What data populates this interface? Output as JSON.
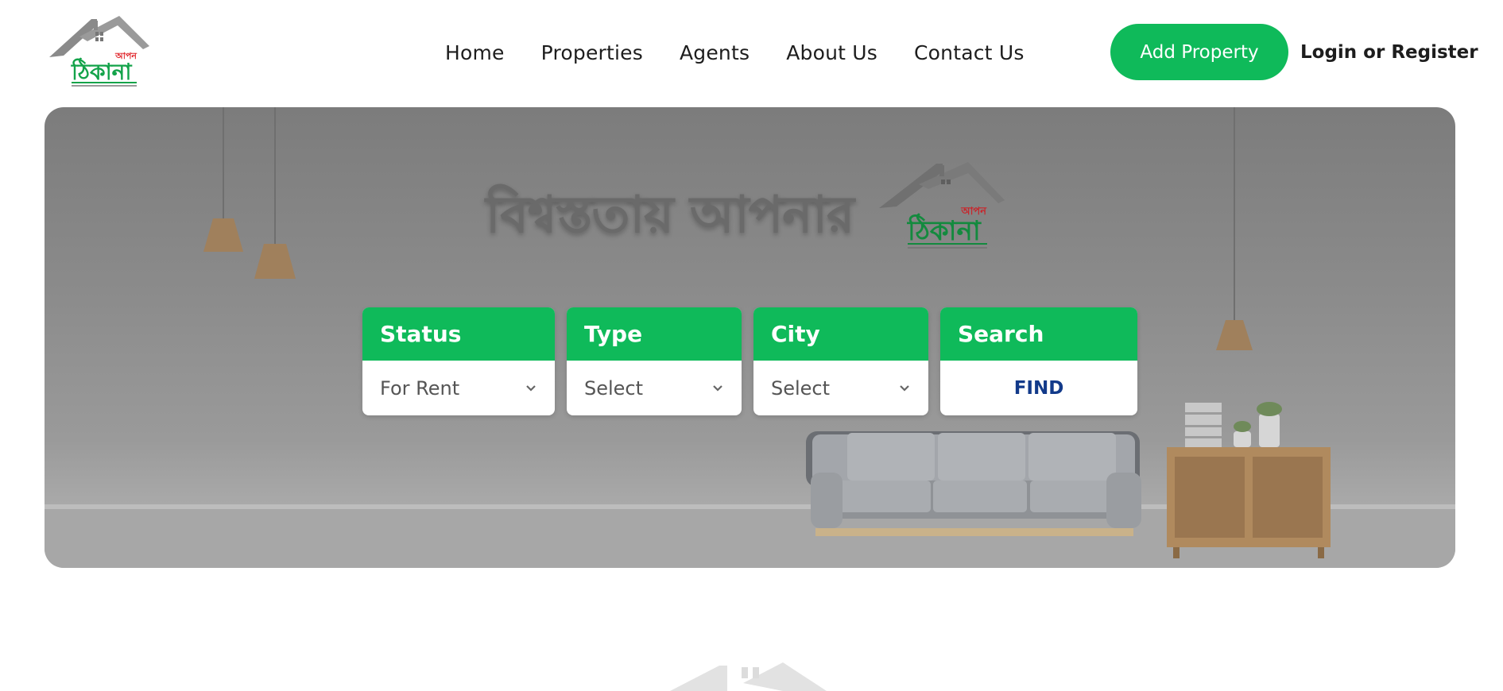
{
  "brand": {
    "logo_text": "ঠিকানা",
    "logo_small": "আপন",
    "accent_green": "#0fba5a",
    "accent_red": "#e0252b",
    "find_blue": "#123a8a"
  },
  "nav": {
    "items": [
      {
        "label": "Home"
      },
      {
        "label": "Properties"
      },
      {
        "label": "Agents"
      },
      {
        "label": "About Us"
      },
      {
        "label": "Contact Us"
      }
    ],
    "add_property": "Add Property",
    "login": "Login or Register"
  },
  "hero": {
    "tagline": "বিশ্বস্ততায় আপনার",
    "logo_text": "ঠিকানা",
    "logo_small": "আপন"
  },
  "search": {
    "status": {
      "label": "Status",
      "value": "For Rent"
    },
    "type": {
      "label": "Type",
      "value": "Select"
    },
    "city": {
      "label": "City",
      "value": "Select"
    },
    "submit": {
      "label": "Search",
      "button": "FIND"
    }
  },
  "icons": {
    "logo": "house-roof-logo-icon",
    "dropdown": "chevron-down-icon"
  }
}
